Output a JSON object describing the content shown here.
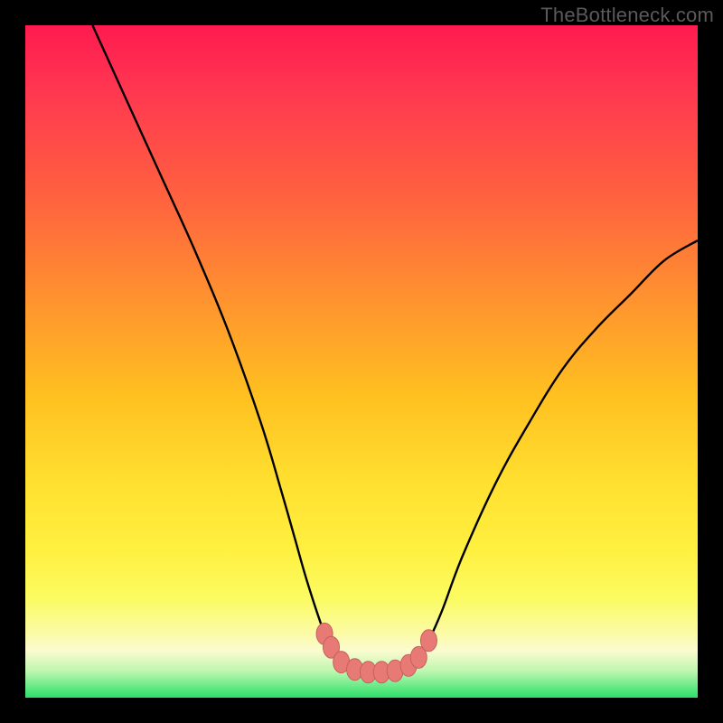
{
  "watermark": "TheBottleneck.com",
  "colors": {
    "frame": "#000000",
    "curve_stroke": "#000000",
    "marker_fill": "#e87a76",
    "marker_stroke": "#c6605c"
  },
  "chart_data": {
    "type": "line",
    "title": "",
    "xlabel": "",
    "ylabel": "",
    "xlim": [
      0,
      100
    ],
    "ylim": [
      0,
      100
    ],
    "series": [
      {
        "name": "bottleneck-curve",
        "x": [
          10,
          15,
          20,
          25,
          30,
          35,
          38,
          40,
          42,
          44.5,
          45.5,
          47,
          49,
          51,
          53,
          55,
          57,
          58.5,
          60,
          62,
          65,
          70,
          75,
          80,
          85,
          90,
          95,
          100
        ],
        "values": [
          100,
          89,
          78,
          67,
          55,
          41,
          31,
          24,
          17,
          9.5,
          7.5,
          5.3,
          4.2,
          3.8,
          3.8,
          4.0,
          4.8,
          6.0,
          8.5,
          13,
          21,
          32,
          41,
          49,
          55,
          60,
          65,
          68
        ]
      }
    ],
    "markers": [
      {
        "x": 44.5,
        "y": 9.5
      },
      {
        "x": 45.5,
        "y": 7.5
      },
      {
        "x": 47.0,
        "y": 5.3
      },
      {
        "x": 49.0,
        "y": 4.2
      },
      {
        "x": 51.0,
        "y": 3.8
      },
      {
        "x": 53.0,
        "y": 3.8
      },
      {
        "x": 55.0,
        "y": 4.0
      },
      {
        "x": 57.0,
        "y": 4.8
      },
      {
        "x": 58.5,
        "y": 6.0
      },
      {
        "x": 60.0,
        "y": 8.5
      }
    ]
  }
}
